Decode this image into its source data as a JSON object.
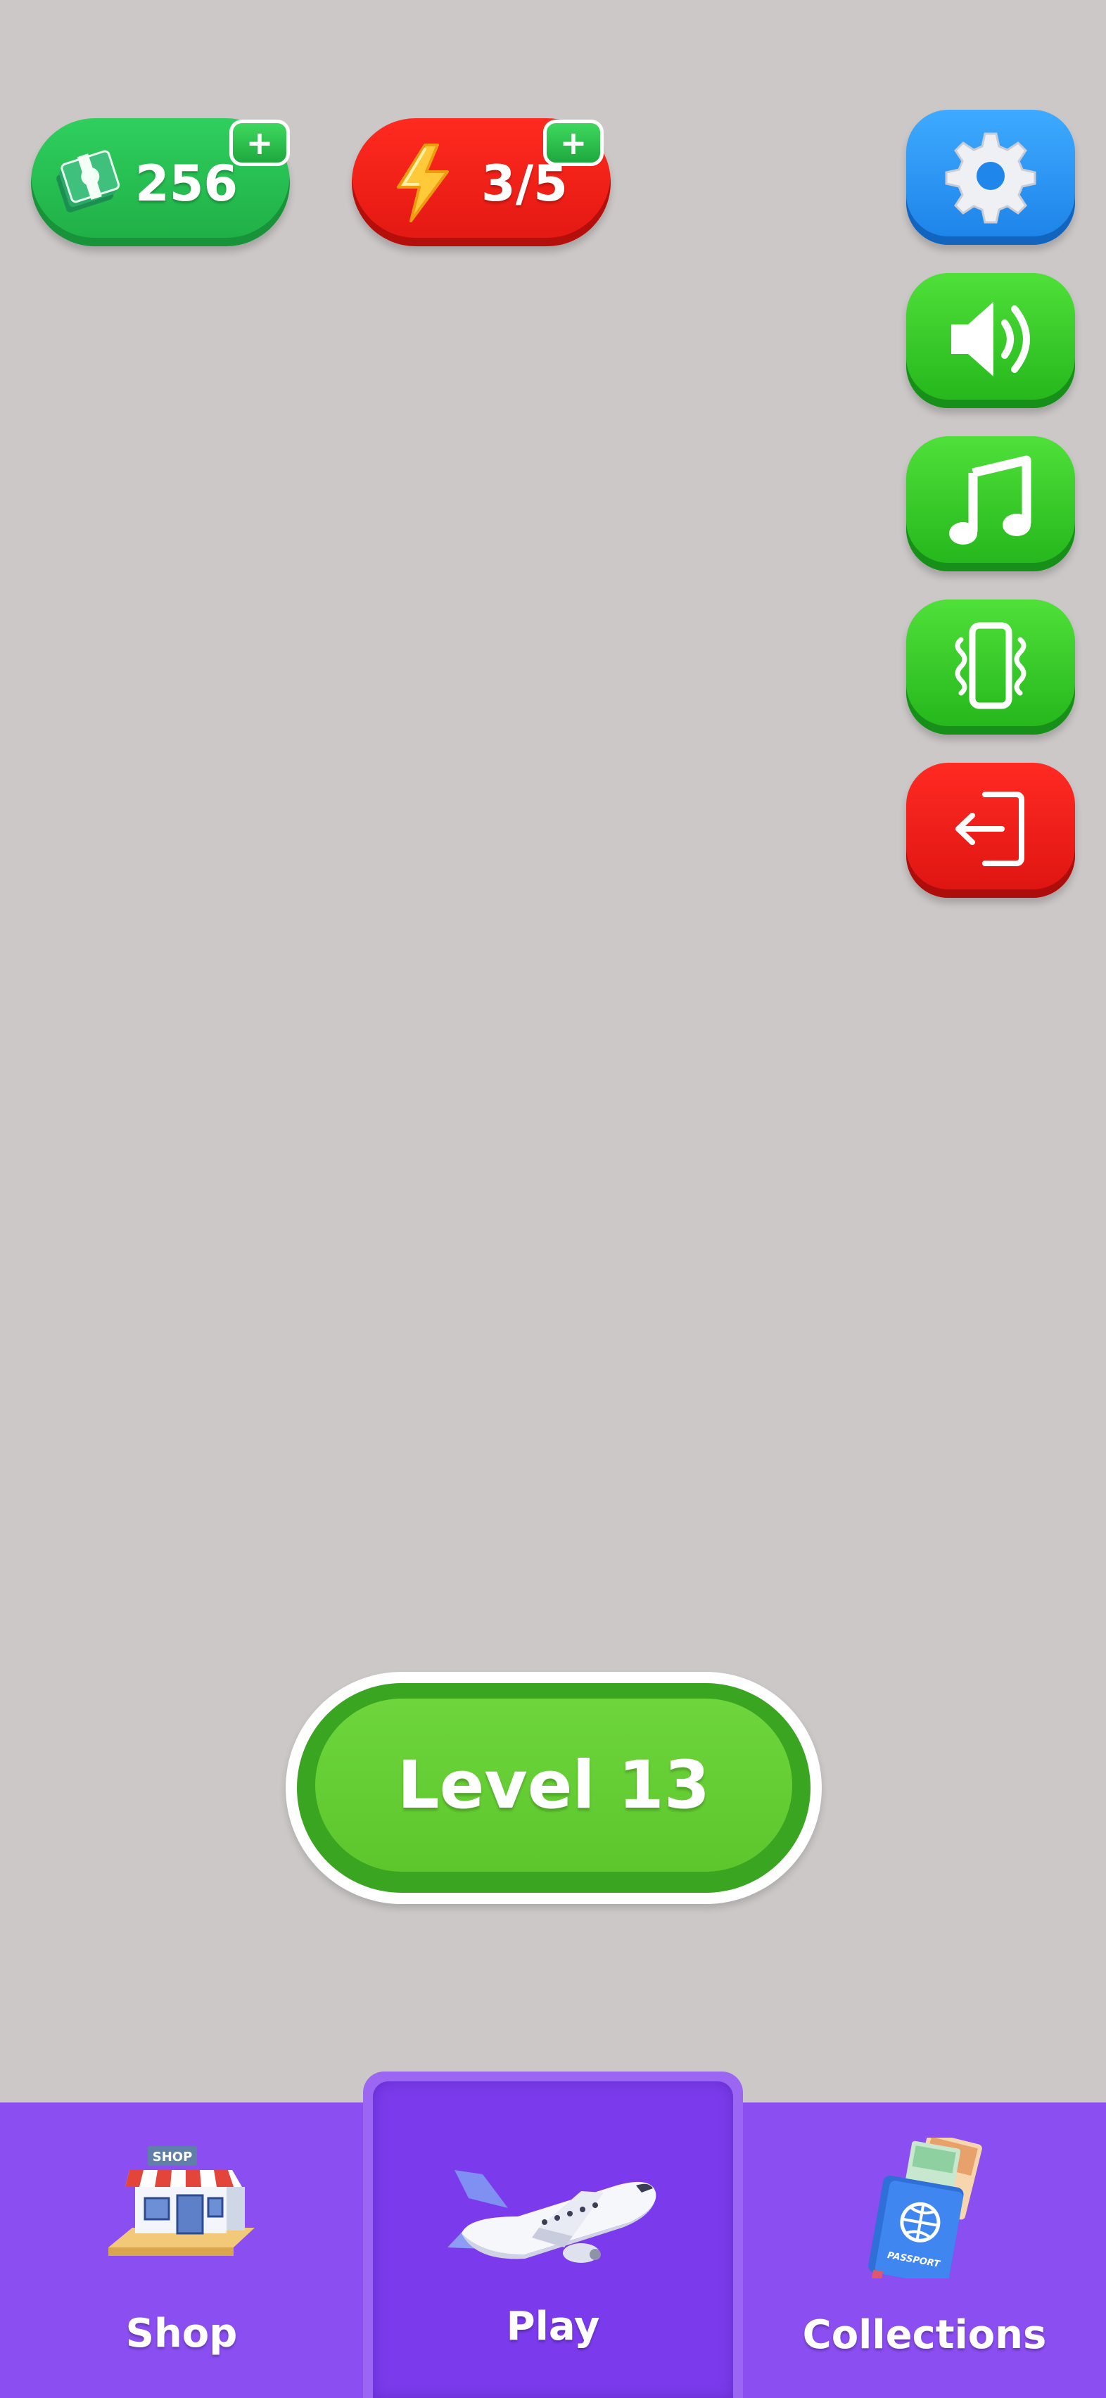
{
  "hud": {
    "cash": {
      "value": "256",
      "icon": "cash-stack-icon",
      "plus": "+"
    },
    "energy": {
      "value": "3/5",
      "icon": "lightning-bolt-icon",
      "plus": "+"
    }
  },
  "side_buttons": [
    {
      "name": "settings-button",
      "icon": "gear-icon",
      "color": "#2b96f5"
    },
    {
      "name": "sound-button",
      "icon": "speaker-icon",
      "color": "#35c52a"
    },
    {
      "name": "music-button",
      "icon": "music-note-icon",
      "color": "#35c52a"
    },
    {
      "name": "vibration-button",
      "icon": "vibration-phone-icon",
      "color": "#35c52a"
    },
    {
      "name": "exit-button",
      "icon": "exit-door-icon",
      "color": "#ee1d18"
    }
  ],
  "level_button": {
    "label": "Level 13"
  },
  "bottom_nav": {
    "tabs": [
      {
        "label": "Shop",
        "icon": "shop-building-icon",
        "sign": "SHOP"
      },
      {
        "label": "Play",
        "icon": "airplane-icon",
        "selected": true
      },
      {
        "label": "Collections",
        "icon": "passport-icon",
        "sign": "PASSPORT"
      }
    ]
  },
  "colors": {
    "background": "#ccc8c8",
    "nav": "#8b4ef0",
    "nav_selected": "#7b3bec",
    "level_green": "#62cc30"
  }
}
